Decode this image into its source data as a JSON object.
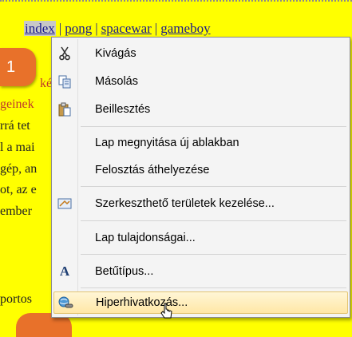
{
  "nav": {
    "links": [
      "index",
      "pong",
      "spacewar",
      "gameboy"
    ],
    "separator": "|"
  },
  "content": {
    "l1": "ké",
    "l2": "geinek",
    "l3": "rrá tet",
    "l4": "l a mai",
    "l5": "gép, an",
    "l6": "ot, az e",
    "l7": "ember",
    "l8": "portos"
  },
  "badge": {
    "number": "1"
  },
  "menu": {
    "items": [
      {
        "label": "Kivágás",
        "icon": "scissors-icon"
      },
      {
        "label": "Másolás",
        "icon": "copy-icon"
      },
      {
        "label": "Beillesztés",
        "icon": "paste-icon"
      },
      {
        "label": "Lap megnyitása új ablakban"
      },
      {
        "label": "Felosztás áthelyezése"
      },
      {
        "label": "Szerkeszthető területek kezelése...",
        "icon": "editable-regions-icon"
      },
      {
        "label": "Lap tulajdonságai..."
      },
      {
        "label": "Betűtípus...",
        "icon": "font-icon",
        "icon_glyph": "A"
      },
      {
        "label": "Hiperhivatkozás...",
        "icon": "hyperlink-icon",
        "highlighted": true
      }
    ]
  },
  "colors": {
    "page_bg": "#ffff00",
    "badge": "#e8712a",
    "menu_bg": "#f4f4f4",
    "highlight": "#ffe7a6"
  }
}
